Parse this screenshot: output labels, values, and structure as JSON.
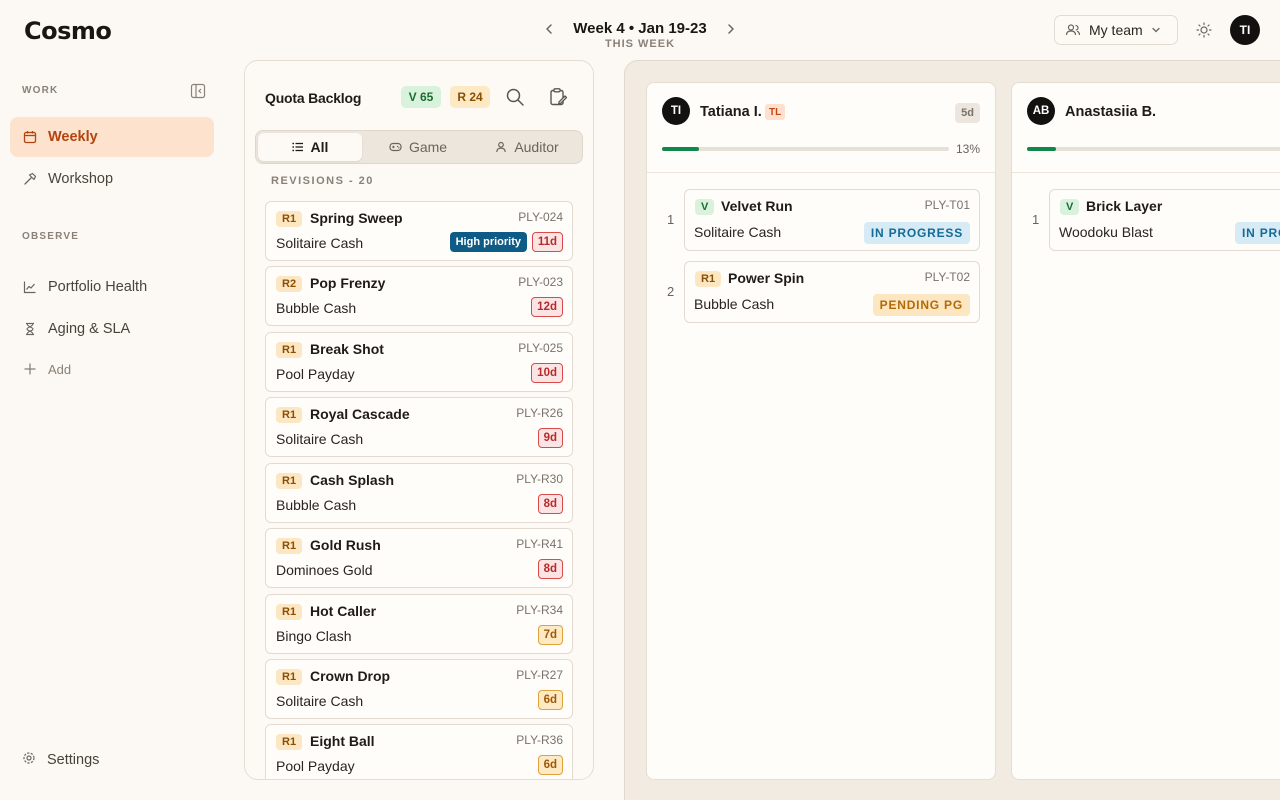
{
  "app": {
    "logo_text": "Cosmo"
  },
  "header": {
    "week_title": "Week 4 • Jan 19-23",
    "week_subtitle": "THIS WEEK",
    "team_label": "My team",
    "avatar_initials": "TI"
  },
  "sidebar": {
    "section_work": "WORK",
    "section_observe": "OBSERVE",
    "items": [
      {
        "label": "Weekly",
        "icon": "calendar-icon"
      },
      {
        "label": "Workshop",
        "icon": "hammer-icon"
      },
      {
        "label": "Portfolio Health",
        "icon": "chart-line-icon"
      },
      {
        "label": "Aging & SLA",
        "icon": "hourglass-icon"
      }
    ],
    "add_label": "Add",
    "settings_label": "Settings"
  },
  "backlog": {
    "title": "Quota Backlog",
    "v_count": "V 65",
    "r_count": "R 24",
    "tabs": [
      "All",
      "Game",
      "Auditor"
    ],
    "section_label": "REVISIONS  - 20",
    "cards": [
      {
        "tag": "R1",
        "name": "Spring Sweep",
        "code": "PLY-024",
        "game": "Solitaire Cash",
        "priority": "High priority",
        "age": "11d",
        "age_level": "red"
      },
      {
        "tag": "R2",
        "name": "Pop Frenzy",
        "code": "PLY-023",
        "game": "Bubble Cash",
        "age": "12d",
        "age_level": "red"
      },
      {
        "tag": "R1",
        "name": "Break Shot",
        "code": "PLY-025",
        "game": "Pool Payday",
        "age": "10d",
        "age_level": "red"
      },
      {
        "tag": "R1",
        "name": "Royal Cascade",
        "code": "PLY-R26",
        "game": "Solitaire Cash",
        "age": "9d",
        "age_level": "red"
      },
      {
        "tag": "R1",
        "name": "Cash Splash",
        "code": "PLY-R30",
        "game": "Bubble Cash",
        "age": "8d",
        "age_level": "red"
      },
      {
        "tag": "R1",
        "name": "Gold Rush",
        "code": "PLY-R41",
        "game": "Dominoes Gold",
        "age": "8d",
        "age_level": "red"
      },
      {
        "tag": "R1",
        "name": "Hot Caller",
        "code": "PLY-R34",
        "game": "Bingo Clash",
        "age": "7d",
        "age_level": "amber"
      },
      {
        "tag": "R1",
        "name": "Crown Drop",
        "code": "PLY-R27",
        "game": "Solitaire Cash",
        "age": "6d",
        "age_level": "amber"
      },
      {
        "tag": "R1",
        "name": "Eight Ball",
        "code": "PLY-R36",
        "game": "Pool Payday",
        "age": "6d",
        "age_level": "amber"
      }
    ]
  },
  "board": {
    "columns": [
      {
        "initials": "TI",
        "name": "Tatiana I.",
        "role_badge": "TL",
        "days": "5d",
        "progress_pct": "13%",
        "progress": 0.13,
        "cards": [
          {
            "num": "1",
            "tag": "V",
            "name": "Velvet Run",
            "code": "PLY-T01",
            "game": "Solitaire Cash",
            "status": "IN PROGRESS"
          },
          {
            "num": "2",
            "tag": "R1",
            "name": "Power Spin",
            "code": "PLY-T02",
            "game": "Bubble Cash",
            "status": "PENDING PG"
          }
        ]
      },
      {
        "initials": "AB",
        "name": "Anastasiia B.",
        "progress": 0.1,
        "cards": [
          {
            "num": "1",
            "tag": "V",
            "name": "Brick Layer",
            "game": "Woodoku Blast",
            "status": "IN PROGRESS"
          }
        ]
      }
    ]
  },
  "colors": {
    "accent": "#b3440f",
    "accent_bg": "#fde2cd",
    "progress_green": "#13864b",
    "priority_blue": "#0e5b86"
  }
}
